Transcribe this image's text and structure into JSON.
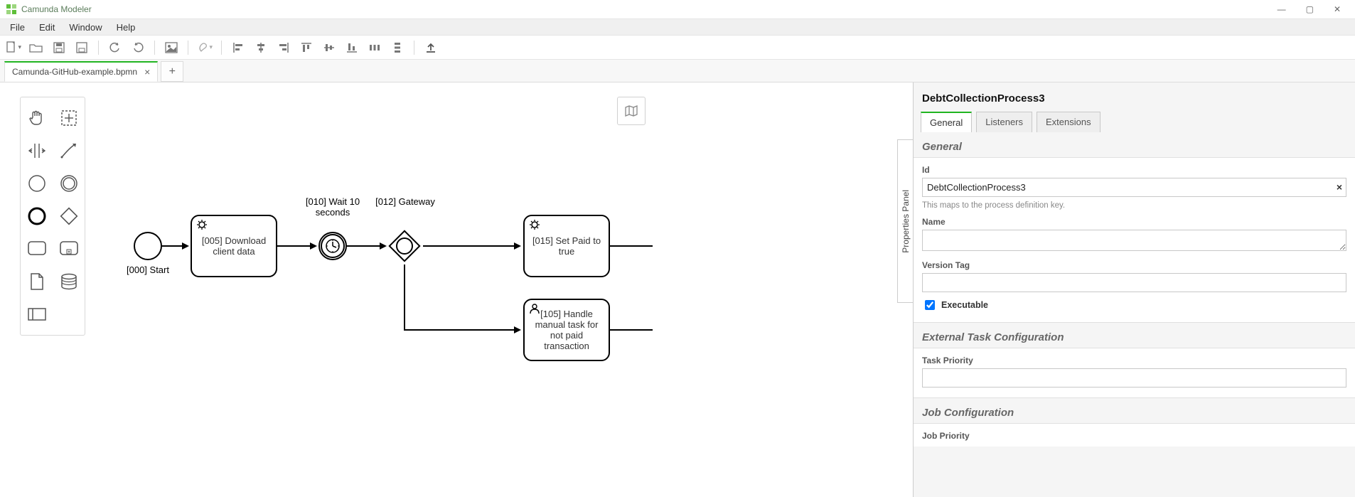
{
  "window": {
    "title": "Camunda Modeler",
    "menus": [
      "File",
      "Edit",
      "Window",
      "Help"
    ]
  },
  "file_tabs": {
    "active": "Camunda-GitHub-example.bpmn"
  },
  "diagram": {
    "start_event": {
      "label": "[000] Start"
    },
    "task_005": {
      "label": "[005] Download client data"
    },
    "timer_010": {
      "label": "[010] Wait 10 seconds"
    },
    "gateway_012": {
      "label": "[012] Gateway"
    },
    "task_015": {
      "label": "[015] Set Paid to true"
    },
    "task_105": {
      "label": "[105] Handle manual task for not paid transaction"
    }
  },
  "properties": {
    "panel_toggle_label": "Properties Panel",
    "element_name": "DebtCollectionProcess3",
    "tabs": {
      "general": "General",
      "listeners": "Listeners",
      "extensions": "Extensions"
    },
    "general_section": {
      "heading": "General",
      "id_label": "Id",
      "id_value": "DebtCollectionProcess3",
      "id_help": "This maps to the process definition key.",
      "name_label": "Name",
      "name_value": "",
      "version_tag_label": "Version Tag",
      "version_tag_value": "",
      "executable_label": "Executable",
      "executable_checked": true
    },
    "external_task_section": {
      "heading": "External Task Configuration",
      "task_priority_label": "Task Priority",
      "task_priority_value": ""
    },
    "job_section": {
      "heading": "Job Configuration",
      "job_priority_label": "Job Priority"
    }
  }
}
